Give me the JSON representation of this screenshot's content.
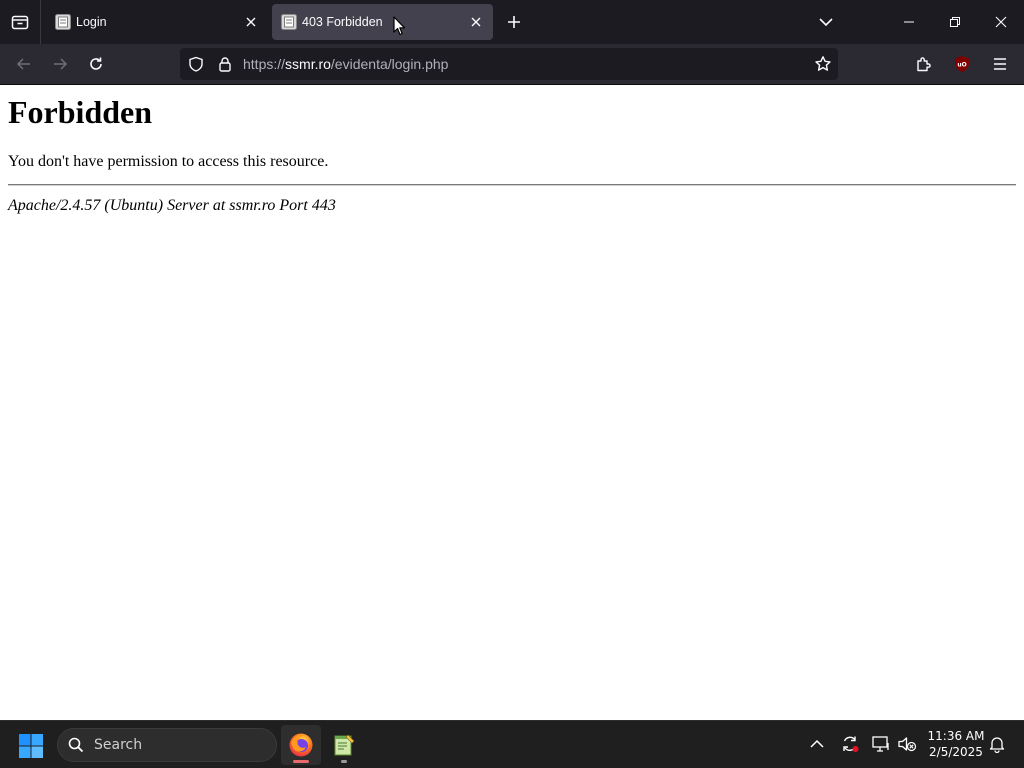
{
  "browser": {
    "tabs": [
      {
        "title": "Login",
        "favicon": "page-favicon-icon",
        "active": false
      },
      {
        "title": "403 Forbidden",
        "favicon": "page-favicon-icon",
        "active": true
      }
    ],
    "url": {
      "scheme": "https://",
      "host": "ssmr.ro",
      "path": "/evidenta/login.php"
    },
    "colors": {
      "tabbar_bg": "#1c1b22",
      "active_tab_bg": "#42414d",
      "navbar_bg": "#2b2a33",
      "urlbar_bg": "#1c1b22",
      "ublock_red": "#800000"
    }
  },
  "page": {
    "heading": "Forbidden",
    "message": "You don't have permission to access this resource.",
    "server_signature": "Apache/2.4.57 (Ubuntu) Server at ssmr.ro Port 443"
  },
  "taskbar": {
    "search_label": "Search",
    "apps": [
      {
        "name": "Firefox",
        "icon": "firefox-icon",
        "active": true
      },
      {
        "name": "Notepad++",
        "icon": "notepad-plus-plus-icon",
        "active": false
      }
    ],
    "clock": {
      "time": "11:36 AM",
      "date": "2/5/2025"
    },
    "colors": {
      "bg": "#1f1f1f",
      "start_blue": "#1e90ff"
    }
  }
}
